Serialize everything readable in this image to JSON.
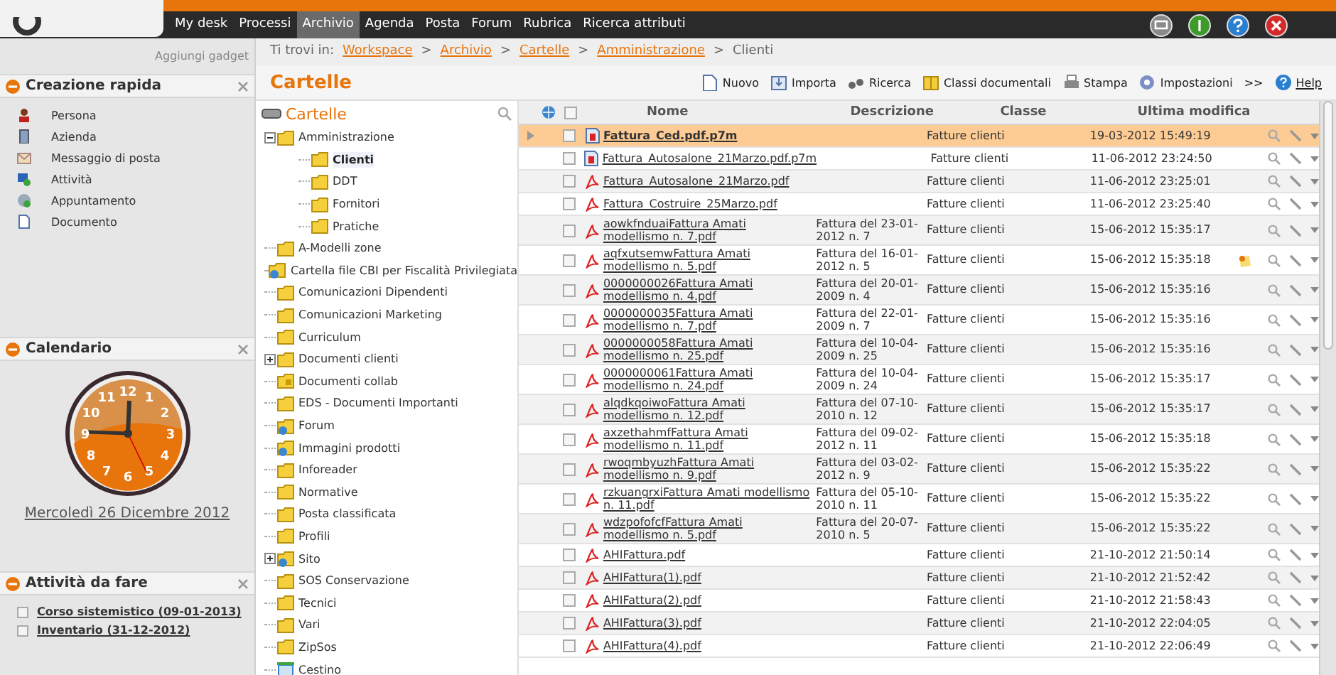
{
  "nav": {
    "items": [
      {
        "label": "My desk",
        "selected": false
      },
      {
        "label": "Processi",
        "selected": false
      },
      {
        "label": "Archivio",
        "selected": true
      },
      {
        "label": "Agenda",
        "selected": false
      },
      {
        "label": "Posta",
        "selected": false
      },
      {
        "label": "Forum",
        "selected": false
      },
      {
        "label": "Rubrica",
        "selected": false
      },
      {
        "label": "Ricerca attributi",
        "selected": false
      }
    ],
    "buttons": [
      {
        "kind": "monitor",
        "color": "#8a8a8a"
      },
      {
        "kind": "info",
        "color": "#3f9a2c"
      },
      {
        "kind": "help",
        "color": "#2a7fd0"
      },
      {
        "kind": "close",
        "color": "#d42a2a"
      }
    ]
  },
  "sidebar": {
    "add_gadget": "Aggiungi gadget",
    "quick_create": {
      "title": "Creazione rapida",
      "items": [
        {
          "label": "Persona",
          "kind": "person"
        },
        {
          "label": "Azienda",
          "kind": "company"
        },
        {
          "label": "Messaggio di posta",
          "kind": "mail"
        },
        {
          "label": "Attività",
          "kind": "task"
        },
        {
          "label": "Appuntamento",
          "kind": "appointment"
        },
        {
          "label": "Documento",
          "kind": "document"
        }
      ]
    },
    "calendar": {
      "title": "Calendario",
      "clock_numerals": [
        "12",
        "11",
        "1",
        "10",
        "2",
        "9",
        "3",
        "8",
        "4",
        "7",
        "5",
        "6"
      ],
      "date": "Mercoledì 26 Dicembre 2012"
    },
    "todo": {
      "title": "Attività da fare",
      "items": [
        {
          "label": "Corso sistemistico (09-01-2013)",
          "checked": false
        },
        {
          "label": "Inventario (31-12-2012)",
          "checked": false
        }
      ]
    }
  },
  "breadcrumb": {
    "prefix": "Ti trovi in:",
    "separator": ">",
    "links": [
      "Workspace",
      "Archivio",
      "Cartelle",
      "Amministrazione"
    ],
    "current": "Clienti"
  },
  "page_title": "Cartelle",
  "toolbar": [
    {
      "label": "Nuovo",
      "kind": "new"
    },
    {
      "label": "Importa",
      "kind": "import"
    },
    {
      "label": "Ricerca",
      "kind": "search"
    },
    {
      "label": "Classi documentali",
      "kind": "classes"
    },
    {
      "label": "Stampa",
      "kind": "print"
    },
    {
      "label": "Impostazioni",
      "kind": "settings"
    },
    {
      "label": ">>",
      "kind": "more"
    },
    {
      "label": "Help",
      "kind": "help"
    }
  ],
  "tree": {
    "title": "Cartelle",
    "items": [
      {
        "label": "Amministrazione",
        "kind": "folder",
        "expanded": true,
        "selected": false,
        "children": [
          {
            "label": "Clienti",
            "kind": "folder",
            "selected": true
          },
          {
            "label": "DDT",
            "kind": "folder",
            "selected": false
          },
          {
            "label": "Fornitori",
            "kind": "folder",
            "selected": false
          },
          {
            "label": "Pratiche",
            "kind": "folder",
            "selected": false
          }
        ]
      },
      {
        "label": "A-Modelli zone",
        "kind": "folder",
        "selected": false
      },
      {
        "label": "Cartella file CBI per Fiscalità Privilegiata",
        "kind": "shared",
        "selected": false
      },
      {
        "label": "Comunicazioni Dipendenti",
        "kind": "folder",
        "selected": false
      },
      {
        "label": "Comunicazioni Marketing",
        "kind": "folder",
        "selected": false
      },
      {
        "label": "Curriculum",
        "kind": "folder",
        "selected": false
      },
      {
        "label": "Documenti clienti",
        "kind": "folder",
        "expanded": false,
        "selected": false
      },
      {
        "label": "Documenti collab",
        "kind": "locked",
        "selected": false
      },
      {
        "label": "EDS - Documenti Importanti",
        "kind": "folder",
        "selected": false
      },
      {
        "label": "Forum",
        "kind": "shared",
        "selected": false
      },
      {
        "label": "Immagini prodotti",
        "kind": "shared",
        "selected": false
      },
      {
        "label": "Inforeader",
        "kind": "folder",
        "selected": false
      },
      {
        "label": "Normative",
        "kind": "folder",
        "selected": false
      },
      {
        "label": "Posta classificata",
        "kind": "folder",
        "selected": false
      },
      {
        "label": "Profili",
        "kind": "folder",
        "selected": false
      },
      {
        "label": "Sito",
        "kind": "shared",
        "expanded": false,
        "selected": false
      },
      {
        "label": "SOS Conservazione",
        "kind": "folder",
        "selected": false
      },
      {
        "label": "Tecnici",
        "kind": "folder",
        "selected": false
      },
      {
        "label": "Vari",
        "kind": "folder",
        "selected": false
      },
      {
        "label": "ZipSos",
        "kind": "folder",
        "selected": false
      },
      {
        "label": "Cestino",
        "kind": "trash",
        "selected": false
      }
    ]
  },
  "table": {
    "select_all": {
      "checked": false
    },
    "columns": [
      "Nome",
      "Descrizione",
      "Classe",
      "Ultima modifica"
    ],
    "rows": [
      {
        "name": "Fattura_Ced.pdf.p7m",
        "kind": "signed",
        "description": "",
        "class": "Fatture clienti",
        "modified": "19-03-2012 15:49:19",
        "selected": true,
        "note": false
      },
      {
        "name": "Fattura_Autosalone_21Marzo.pdf.p7m",
        "kind": "signed",
        "description": "",
        "class": "Fatture clienti",
        "modified": "11-06-2012 23:24:50",
        "selected": false,
        "note": false
      },
      {
        "name": "Fattura_Autosalone_21Marzo.pdf",
        "kind": "pdf",
        "description": "",
        "class": "Fatture clienti",
        "modified": "11-06-2012 23:25:01",
        "selected": false,
        "note": false
      },
      {
        "name": "Fattura_Costruire_25Marzo.pdf",
        "kind": "pdf",
        "description": "",
        "class": "Fatture clienti",
        "modified": "11-06-2012 23:25:40",
        "selected": false,
        "note": false
      },
      {
        "name": "aowkfnduaiFattura Amati modellismo n. 7.pdf",
        "kind": "pdf",
        "description": "Fattura del 23-01-2012 n. 7",
        "class": "Fatture clienti",
        "modified": "15-06-2012 15:35:17",
        "selected": false,
        "note": false
      },
      {
        "name": "aqfxutsemwFattura Amati modellismo n. 5.pdf",
        "kind": "pdf",
        "description": "Fattura del 16-01-2012 n. 5",
        "class": "Fatture clienti",
        "modified": "15-06-2012 15:35:18",
        "selected": false,
        "note": true
      },
      {
        "name": "0000000026Fattura Amati modellismo n. 4.pdf",
        "kind": "pdf",
        "description": "Fattura del 20-01-2009 n. 4",
        "class": "Fatture clienti",
        "modified": "15-06-2012 15:35:16",
        "selected": false,
        "note": false
      },
      {
        "name": "0000000035Fattura Amati modellismo n. 7.pdf",
        "kind": "pdf",
        "description": "Fattura del 22-01-2009 n. 7",
        "class": "Fatture clienti",
        "modified": "15-06-2012 15:35:16",
        "selected": false,
        "note": false
      },
      {
        "name": "0000000058Fattura Amati modellismo n. 25.pdf",
        "kind": "pdf",
        "description": "Fattura del 10-04-2009 n. 25",
        "class": "Fatture clienti",
        "modified": "15-06-2012 15:35:16",
        "selected": false,
        "note": false
      },
      {
        "name": "0000000061Fattura Amati modellismo n. 24.pdf",
        "kind": "pdf",
        "description": "Fattura del 10-04-2009 n. 24",
        "class": "Fatture clienti",
        "modified": "15-06-2012 15:35:17",
        "selected": false,
        "note": false
      },
      {
        "name": "alqdkqoiwoFattura Amati modellismo n. 12.pdf",
        "kind": "pdf",
        "description": "Fattura del 07-10-2010 n. 12",
        "class": "Fatture clienti",
        "modified": "15-06-2012 15:35:17",
        "selected": false,
        "note": false
      },
      {
        "name": "axzethahmfFattura Amati modellismo n. 11.pdf",
        "kind": "pdf",
        "description": "Fattura del 09-02-2012 n. 11",
        "class": "Fatture clienti",
        "modified": "15-06-2012 15:35:18",
        "selected": false,
        "note": false
      },
      {
        "name": "rwoqmbyuzhFattura Amati modellismo n. 9.pdf",
        "kind": "pdf",
        "description": "Fattura del 03-02-2012 n. 9",
        "class": "Fatture clienti",
        "modified": "15-06-2012 15:35:22",
        "selected": false,
        "note": false
      },
      {
        "name": "rzkuangrxiFattura Amati modellismo n. 11.pdf",
        "kind": "pdf",
        "description": "Fattura del 05-10-2010 n. 11",
        "class": "Fatture clienti",
        "modified": "15-06-2012 15:35:22",
        "selected": false,
        "note": false
      },
      {
        "name": "wdzpofofcfFattura Amati modellismo n. 5.pdf",
        "kind": "pdf",
        "description": "Fattura del 20-07-2010 n. 5",
        "class": "Fatture clienti",
        "modified": "15-06-2012 15:35:22",
        "selected": false,
        "note": false
      },
      {
        "name": "AHIFattura.pdf",
        "kind": "pdf",
        "description": "",
        "class": "Fatture clienti",
        "modified": "21-10-2012 21:50:14",
        "selected": false,
        "note": false
      },
      {
        "name": "AHIFattura(1).pdf",
        "kind": "pdf",
        "description": "",
        "class": "Fatture clienti",
        "modified": "21-10-2012 21:52:42",
        "selected": false,
        "note": false
      },
      {
        "name": "AHIFattura(2).pdf",
        "kind": "pdf",
        "description": "",
        "class": "Fatture clienti",
        "modified": "21-10-2012 21:58:43",
        "selected": false,
        "note": false
      },
      {
        "name": "AHIFattura(3).pdf",
        "kind": "pdf",
        "description": "",
        "class": "Fatture clienti",
        "modified": "21-10-2012 22:04:05",
        "selected": false,
        "note": false
      },
      {
        "name": "AHIFattura(4).pdf",
        "kind": "pdf",
        "description": "",
        "class": "Fatture clienti",
        "modified": "21-10-2012 22:06:49",
        "selected": false,
        "note": false
      }
    ]
  }
}
